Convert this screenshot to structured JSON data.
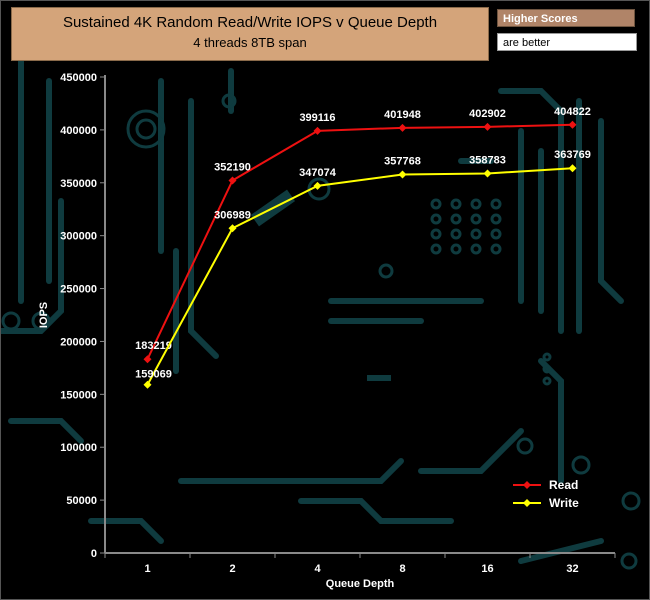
{
  "header": {
    "note_head": "Higher Scores",
    "note_body": "are better"
  },
  "chart_data": {
    "type": "line",
    "title": "Sustained 4K Random Read/Write IOPS v Queue Depth",
    "subtitle": "4 threads 8TB span",
    "xlabel": "Queue Depth",
    "ylabel": "IOPS",
    "categories": [
      "1",
      "2",
      "4",
      "8",
      "16",
      "32"
    ],
    "ylim": [
      0,
      450000
    ],
    "yticks": [
      0,
      50000,
      100000,
      150000,
      200000,
      250000,
      300000,
      350000,
      400000,
      450000
    ],
    "grid": false,
    "legend_position": "bottom-right",
    "series": [
      {
        "name": "Read",
        "color": "#ee1111",
        "values": [
          183219,
          352190,
          399116,
          401948,
          402902,
          404822
        ]
      },
      {
        "name": "Write",
        "color": "#ffff00",
        "values": [
          159069,
          306989,
          347074,
          357768,
          358783,
          363769
        ]
      }
    ],
    "background_color": "#000000",
    "decoration_color": "#0f3b3f"
  }
}
